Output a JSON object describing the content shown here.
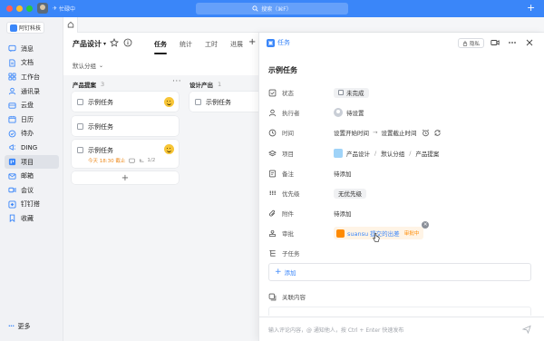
{
  "window": {
    "status": "忙碌中",
    "search_placeholder": "搜索（⌘F）",
    "traffic_colors": [
      "#ff5f57",
      "#febc2e",
      "#28c840"
    ]
  },
  "sidebar": {
    "org": "阿钉科技",
    "items": [
      {
        "label": "消息",
        "icon": "message-icon"
      },
      {
        "label": "文档",
        "icon": "document-icon"
      },
      {
        "label": "工作台",
        "icon": "workbench-icon"
      },
      {
        "label": "通讯录",
        "icon": "contacts-icon"
      },
      {
        "label": "云盘",
        "icon": "cloud-drive-icon"
      },
      {
        "label": "日历",
        "icon": "calendar-icon"
      },
      {
        "label": "待办",
        "icon": "todo-icon"
      },
      {
        "label": "DING",
        "icon": "ding-icon"
      },
      {
        "label": "项目",
        "icon": "project-icon"
      },
      {
        "label": "邮箱",
        "icon": "mail-icon"
      },
      {
        "label": "会议",
        "icon": "meeting-icon"
      },
      {
        "label": "钉钉搭",
        "icon": "dingtalk-builder-icon"
      },
      {
        "label": "收藏",
        "icon": "favorites-icon"
      }
    ],
    "active_index": 8,
    "more_label": "更多"
  },
  "project": {
    "title": "产品设计",
    "view_tabs": [
      "任务",
      "统计",
      "工时",
      "进展"
    ],
    "active_tab": 0,
    "filter": "默认分组"
  },
  "board": {
    "columns": [
      {
        "name": "产品提案",
        "count": "3"
      },
      {
        "name": "设计产出",
        "count": "1"
      }
    ],
    "cards": [
      {
        "title": "示例任务"
      },
      {
        "title": "示例任务"
      },
      {
        "title": "示例任务",
        "due": "今天 18:30 截止",
        "subtasks": "1/2"
      },
      {
        "title": "示例任务"
      }
    ]
  },
  "detail": {
    "type_label": "任务",
    "privacy_label": "隐私",
    "title": "示例任务",
    "fields": {
      "status": {
        "label": "状态",
        "value": "未完成"
      },
      "assignee": {
        "label": "执行者",
        "value": "待设置"
      },
      "time": {
        "label": "时间",
        "start": "设置开始时间",
        "arrow": "→",
        "end": "设置截止时间"
      },
      "project": {
        "label": "项目",
        "path": [
          "产品设计",
          "默认分组",
          "产品提案"
        ]
      },
      "note": {
        "label": "备注",
        "value": "待添加"
      },
      "priority": {
        "label": "优先级",
        "value": "无优先级"
      },
      "attachment": {
        "label": "附件",
        "value": "待添加"
      },
      "approval": {
        "label": "审批",
        "name": "suansu 提交的出差",
        "state": "审批中"
      },
      "subtask": {
        "label": "子任务",
        "add": "添加"
      },
      "related": {
        "label": "关联内容"
      }
    },
    "comment_placeholder": "输入评论内容，@ 通知他人，按 Ctrl + Enter 快速发布"
  }
}
